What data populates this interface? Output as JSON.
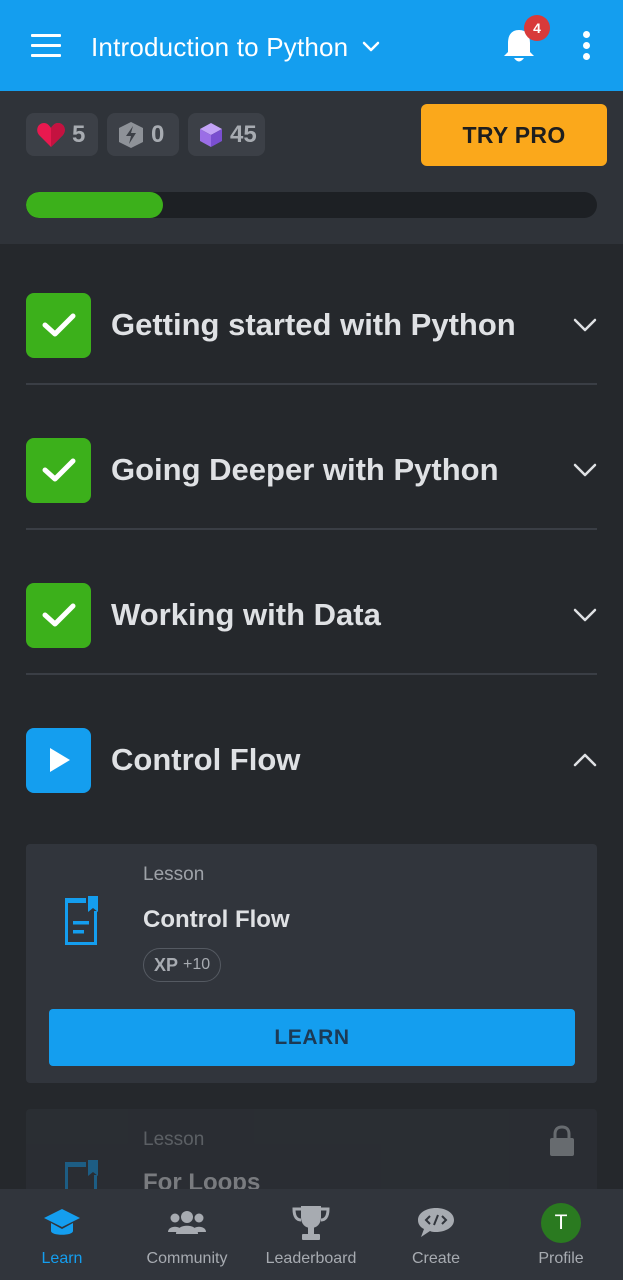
{
  "topbar": {
    "title": "Introduction to Python",
    "notification_count": "4",
    "menu_icon": "hamburger-menu-icon",
    "bell_icon": "bell-icon",
    "more_icon": "more-vertical-icon"
  },
  "stats": {
    "hearts": "5",
    "bolts": "0",
    "gems": "45",
    "try_pro_label": "TRY PRO",
    "progress_fraction": 0.24
  },
  "modules": [
    {
      "title": "Getting started with Python",
      "status": "completed",
      "expanded": false
    },
    {
      "title": "Going Deeper with Python",
      "status": "completed",
      "expanded": false
    },
    {
      "title": "Working with Data",
      "status": "completed",
      "expanded": false
    },
    {
      "title": "Control Flow",
      "status": "in-progress",
      "expanded": true
    }
  ],
  "lessons": [
    {
      "kind": "Lesson",
      "title": "Control Flow",
      "xp_label": "XP",
      "xp_value": "+10",
      "button_label": "LEARN",
      "locked": false
    },
    {
      "kind": "Lesson",
      "title": "For Loops",
      "locked": true
    }
  ],
  "bottom_nav": [
    {
      "label": "Learn",
      "icon": "graduation-cap-icon",
      "active": true
    },
    {
      "label": "Community",
      "icon": "people-icon",
      "active": false
    },
    {
      "label": "Leaderboard",
      "icon": "trophy-icon",
      "active": false
    },
    {
      "label": "Create",
      "icon": "code-chat-icon",
      "active": false
    },
    {
      "label": "Profile",
      "icon": "avatar",
      "avatar_initial": "T",
      "active": false
    }
  ],
  "colors": {
    "brand_blue": "#149eef",
    "success_green": "#3cb01b",
    "pro_orange": "#fba81b",
    "heart_red": "#e8194f",
    "gem_purple": "#9b6ee6"
  }
}
